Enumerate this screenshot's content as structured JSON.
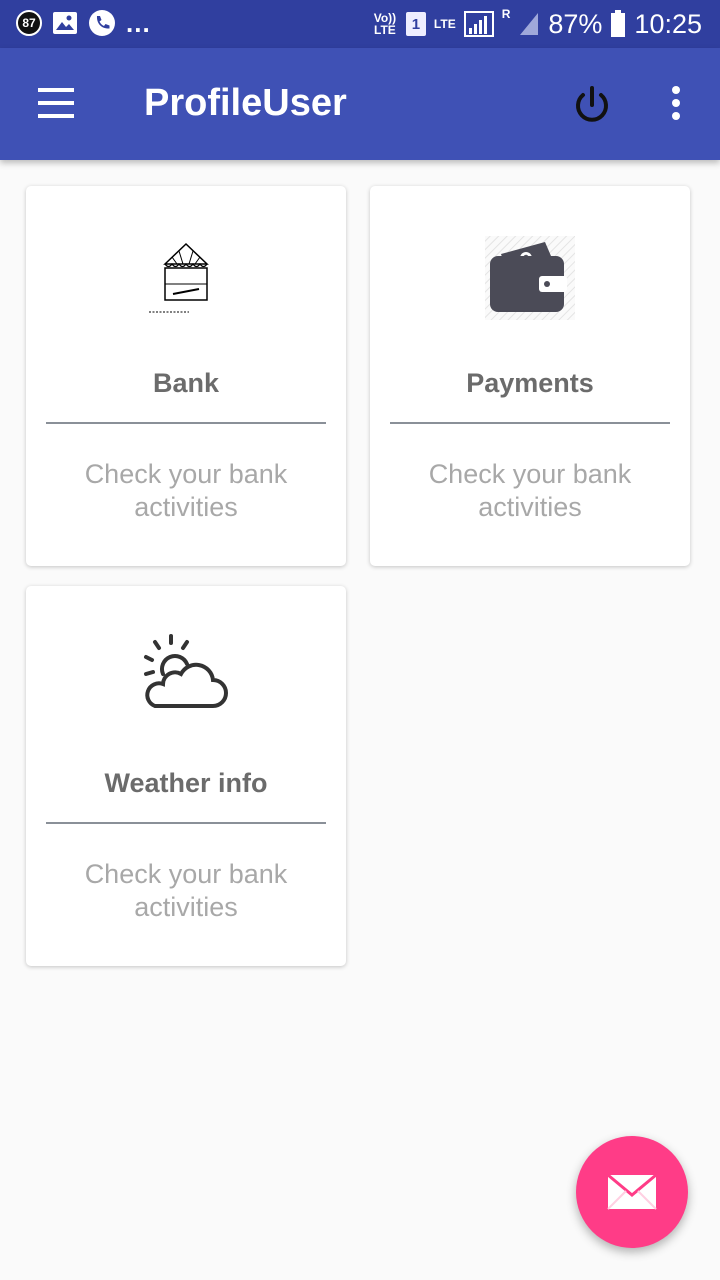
{
  "status_bar": {
    "notification_count": "87",
    "more": "...",
    "volte": "Vo)) LTE",
    "sim": "1",
    "lte": "LTE",
    "roaming": "R",
    "battery": "87%",
    "time": "10:25"
  },
  "toolbar": {
    "title": "ProfileUser"
  },
  "cards": [
    {
      "title": "Bank",
      "description": "Check your bank activities",
      "icon": "bank-icon"
    },
    {
      "title": "Payments",
      "description": "Check your bank activities",
      "icon": "wallet-icon"
    },
    {
      "title": "Weather info",
      "description": "Check your bank activities",
      "icon": "weather-icon"
    }
  ],
  "colors": {
    "status_bar": "#303f9f",
    "toolbar": "#3f51b5",
    "fab": "#ff3c87"
  }
}
